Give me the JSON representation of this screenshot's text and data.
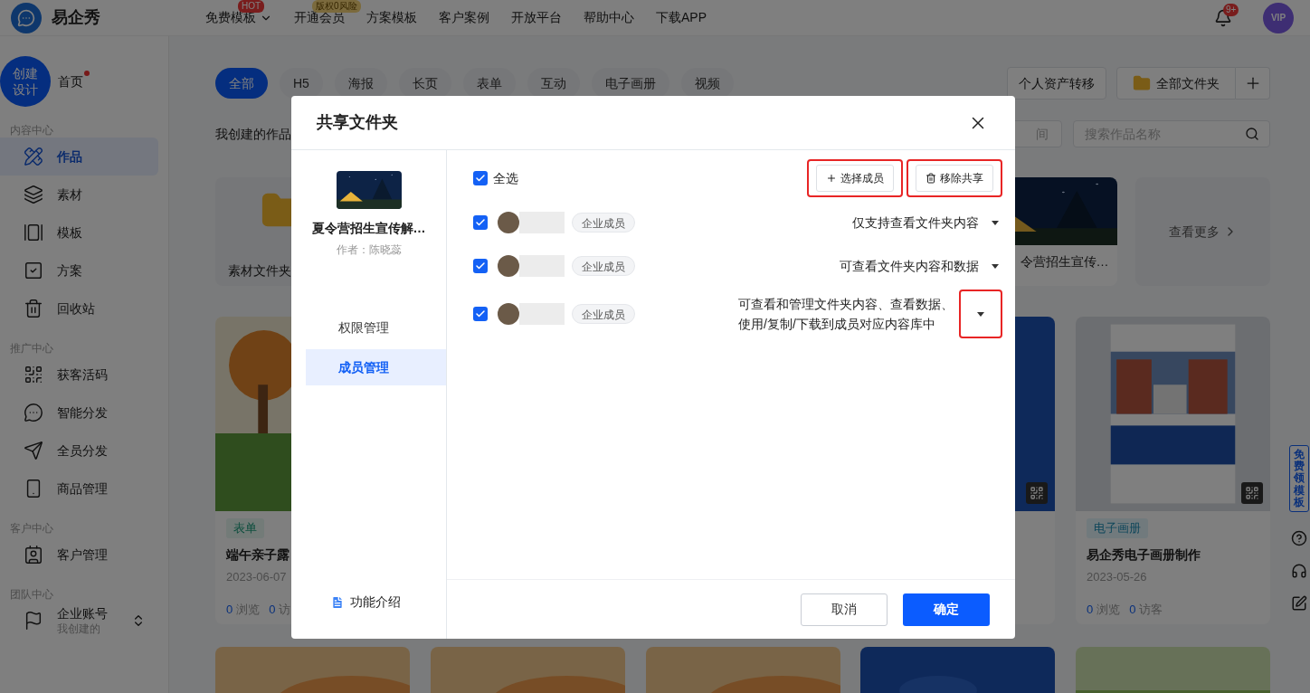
{
  "top_nav": {
    "brand": "易企秀",
    "items": [
      {
        "label": "免费模板",
        "badge": "HOT",
        "dropdown": true
      },
      {
        "label": "开通会员",
        "badge": "版权0风险",
        "dropdown": false
      },
      {
        "label": "方案模板",
        "dropdown": false
      },
      {
        "label": "客户案例",
        "dropdown": false
      },
      {
        "label": "开放平台",
        "dropdown": false
      },
      {
        "label": "帮助中心",
        "dropdown": false
      },
      {
        "label": "下载APP",
        "dropdown": false
      }
    ],
    "notification_count": "9+",
    "avatar_label": "VIP"
  },
  "sidebar": {
    "create_button": "创建设计",
    "home": {
      "label": "首页",
      "dot": true
    },
    "sections": [
      {
        "title": "内容中心",
        "items": [
          {
            "label": "作品",
            "selected": true
          },
          {
            "label": "素材",
            "selected": false
          },
          {
            "label": "模板",
            "selected": false
          },
          {
            "label": "方案",
            "selected": false
          },
          {
            "label": "回收站",
            "selected": false
          }
        ]
      },
      {
        "title": "推广中心",
        "items": [
          {
            "label": "获客活码",
            "selected": false
          },
          {
            "label": "智能分发",
            "selected": false
          },
          {
            "label": "全员分发",
            "selected": false
          },
          {
            "label": "商品管理",
            "selected": false
          }
        ]
      },
      {
        "title": "客户中心",
        "items": [
          {
            "label": "客户管理",
            "selected": false
          }
        ]
      },
      {
        "title": "团队中心",
        "items": [
          {
            "label": "企业账号",
            "sublabel": "我创建的",
            "selected": false
          }
        ]
      }
    ]
  },
  "filters": {
    "tabs": [
      {
        "label": "全部",
        "selected": true
      },
      {
        "label": "H5",
        "selected": false
      },
      {
        "label": "海报",
        "selected": false
      },
      {
        "label": "长页",
        "selected": false
      },
      {
        "label": "表单",
        "selected": false
      },
      {
        "label": "互动",
        "selected": false
      },
      {
        "label": "电子画册",
        "selected": false
      },
      {
        "label": "视频",
        "selected": false
      }
    ],
    "transfer_button": "个人资产转移",
    "folder_select": "全部文件夹"
  },
  "section_title": "我创建的作品",
  "date_field": {
    "placeholder": "间"
  },
  "search": {
    "placeholder": "搜索作品名称"
  },
  "folder_row": {
    "folder_name": "素材文件夹",
    "work_title": "令营招生宣传…",
    "more_link": "查看更多"
  },
  "works": [
    {
      "tag": "表单",
      "title": "端午亲子露",
      "date": "2023-06-07",
      "views": "0",
      "views_label": "浏览",
      "visitors": "0",
      "visitors_label": "访"
    },
    {
      "tag": "电子画册",
      "title": "易企秀电子画册制作",
      "date": "2023-05-26",
      "views": "0",
      "views_label": "浏览",
      "visitors": "0",
      "visitors_label": "访客"
    }
  ],
  "float_bar": {
    "promo": "免费领模板"
  },
  "dialog": {
    "title": "共享文件夹",
    "work": {
      "title": "夏令营招生宣传解…",
      "author": "作者：陈晓蕊"
    },
    "menu": [
      {
        "label": "权限管理",
        "selected": false
      },
      {
        "label": "成员管理",
        "selected": true
      }
    ],
    "help_link": "功能介绍",
    "select_all": {
      "label": "全选",
      "checked": true
    },
    "actions": [
      {
        "kind": "add",
        "label": "选择成员",
        "highlighted": true
      },
      {
        "kind": "remove",
        "label": "移除共享",
        "highlighted": true
      }
    ],
    "members": [
      {
        "checked": true,
        "tag": "企业成员",
        "permission": "仅支持查看文件夹内容",
        "highlighted": false
      },
      {
        "checked": true,
        "tag": "企业成员",
        "permission": "可查看文件夹内容和数据",
        "highlighted": false
      },
      {
        "checked": true,
        "tag": "企业成员",
        "permission": "可查看和管理文件夹内容、查看数据、使用/复制/下载到成员对应内容库中",
        "highlighted": true
      }
    ],
    "buttons": [
      {
        "kind": "secondary",
        "label": "取消"
      },
      {
        "kind": "primary",
        "label": "确定"
      }
    ]
  }
}
